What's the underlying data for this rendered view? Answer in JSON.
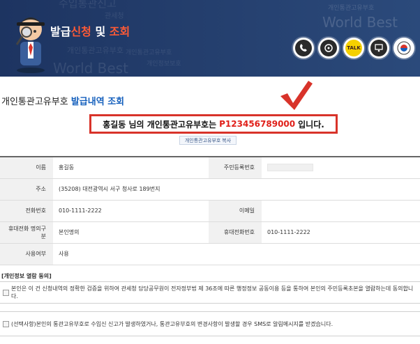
{
  "banner": {
    "title_prefix": "발급",
    "title_highlight1": "신청",
    "title_middle": " 및 ",
    "title_highlight2": "조회",
    "watermarks": [
      "수입통관신고",
      "개인통관고유부호",
      "World Best",
      "개인통관고유부호",
      "World Best",
      "개인정보보호",
      "관세청"
    ],
    "icons": [
      "phone-icon",
      "chat-icon",
      "kakaotalk-icon",
      "presentation-icon",
      "emblem-icon"
    ],
    "kakao_label": "TALK"
  },
  "page": {
    "title_main": "개인통관고유부호",
    "title_blue": "발급내역 조회",
    "result_name": "홍길동",
    "result_mid": "님의 개인통관고유부호는",
    "result_number": "P123456789000",
    "result_suffix": "입니다.",
    "copy_button": "개인통관고유부호 복사"
  },
  "table": {
    "rows": [
      {
        "label1": "이름",
        "value1": "홍길동",
        "label2": "주민등록번호",
        "value2": ""
      },
      {
        "label1": "주소",
        "value1": "(35208)  대전광역시 서구 청사로 189번지",
        "label2": "",
        "value2": ""
      },
      {
        "label1": "전화번호",
        "value1": "010-1111-2222",
        "label2": "이메일",
        "value2": ""
      },
      {
        "label1": "휴대전화 명의구분",
        "value1": "본인명의",
        "label2": "휴대전화번호",
        "value2": "010-1111-2222"
      },
      {
        "label1": "사용여부",
        "value1": "사용",
        "label2": "",
        "value2": ""
      }
    ]
  },
  "consent": {
    "title": "[개인정보 열람 동의]",
    "item1": "본인은 이 건 신청내역의 정확한 검증을 위하여 관세청 담당공무원이 전자정부법 제 36조에 따른 행정정보 공동이용 등을 통하여 본인의 주민등록초본을 열람하는데 동의합니다.",
    "item2": "(선택사항)본인의 통관고유부호로 수입신 신고가 발생하였거나, 통관고유부호의 변경사항이 발생할 경우 SMS로 알림메시지를 받겠습니다."
  }
}
